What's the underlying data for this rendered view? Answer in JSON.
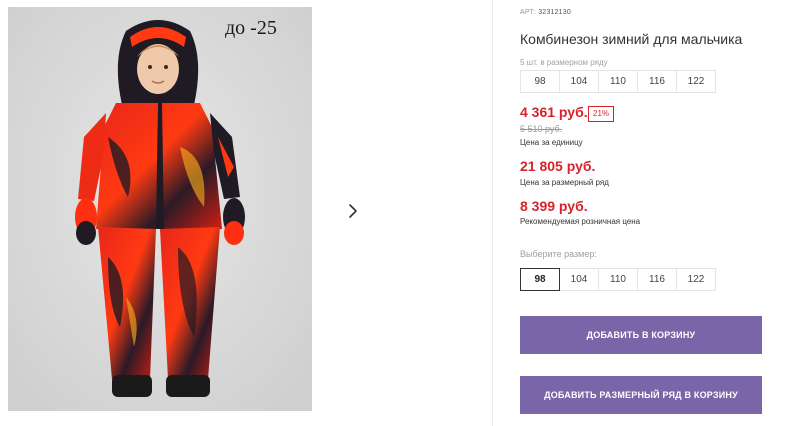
{
  "gallery": {
    "temperature_label": "до -25",
    "next_icon": "chevron-right-icon"
  },
  "product": {
    "article_prefix": "АРТ:",
    "article": "32312130",
    "title": "Комбинезон зимний для мальчика",
    "pack_hint": "5 шт. в размерном ряду",
    "pack_sizes": [
      "98",
      "104",
      "110",
      "116",
      "122"
    ],
    "unit_price": "4 361 руб.",
    "discount": "21%",
    "old_price": "5 510 руб.",
    "unit_price_caption": "Цена за единицу",
    "pack_price": "21 805 руб.",
    "pack_price_caption": "Цена за размерный ряд",
    "retail_price": "8 399 руб.",
    "retail_price_caption": "Рекомендуемая розничная цена",
    "choose_size_label": "Выберите размер:",
    "selectable_sizes": [
      "98",
      "104",
      "110",
      "116",
      "122"
    ],
    "selected_size": "98"
  },
  "actions": {
    "add_to_cart": "ДОБАВИТЬ В КОРЗИНУ",
    "add_pack_to_cart": "ДОБАВИТЬ РАЗМЕРНЫЙ РЯД В КОРЗИНУ"
  },
  "colors": {
    "accent": "#7a65a8",
    "price_red": "#d8222b"
  }
}
